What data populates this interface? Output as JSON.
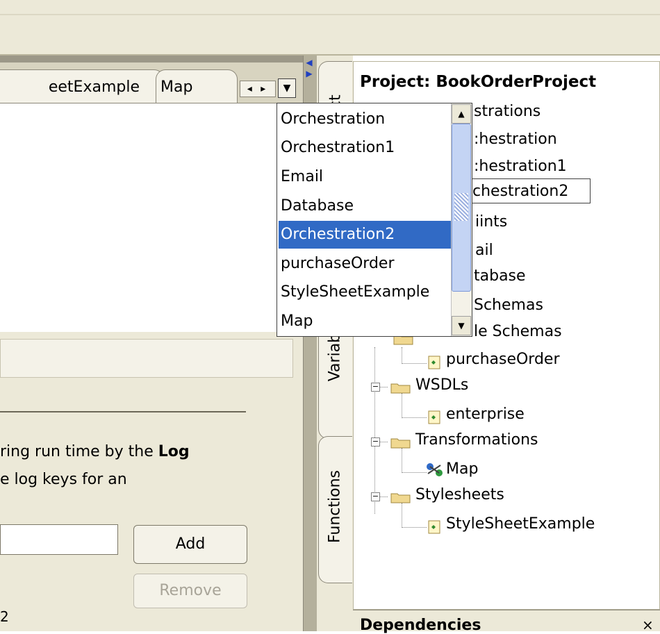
{
  "editor": {
    "tabs": [
      {
        "label": "eetExample"
      },
      {
        "label": "Map"
      }
    ],
    "tab_nav_glyph": "◂ ▸",
    "tab_menu_glyph": "▼",
    "description_line1_prefix": "ring run time by the ",
    "description_line1_bold": "Log",
    "description_line2": "e log keys for an",
    "add_label": "Add",
    "remove_label": "Remove",
    "stray_text": "2"
  },
  "side_tabs": {
    "project": "ect",
    "variables": "Variabl",
    "functions": "Functions"
  },
  "dropdown": {
    "items": [
      "Orchestration",
      "Orchestration1",
      "Email",
      "Database",
      "Orchestration2",
      "purchaseOrder",
      "StyleSheetExample",
      "Map"
    ],
    "selected": "Orchestration2"
  },
  "tree": {
    "project_title": "Project: BookOrderProject",
    "items": [
      {
        "label": "strations"
      },
      {
        "label": ":hestration"
      },
      {
        "label": ":hestration1"
      },
      {
        "label": "chestration2"
      },
      {
        "label": "iints"
      },
      {
        "label": "ail"
      },
      {
        "label": "tabase"
      },
      {
        "label": "Schemas"
      },
      {
        "label": "le Schemas"
      },
      {
        "label": "purchaseOrder"
      },
      {
        "label": "WSDLs"
      },
      {
        "label": "enterprise"
      },
      {
        "label": "Transformations"
      },
      {
        "label": "Map"
      },
      {
        "label": "Stylesheets"
      },
      {
        "label": "StyleSheetExample"
      }
    ],
    "expander_glyph": "−"
  },
  "dependencies": {
    "label": "Dependencies",
    "close": "×"
  },
  "colors": {
    "selection": "#316ac5",
    "panel_bg": "#ece9d8",
    "folder": "#f0d890"
  }
}
